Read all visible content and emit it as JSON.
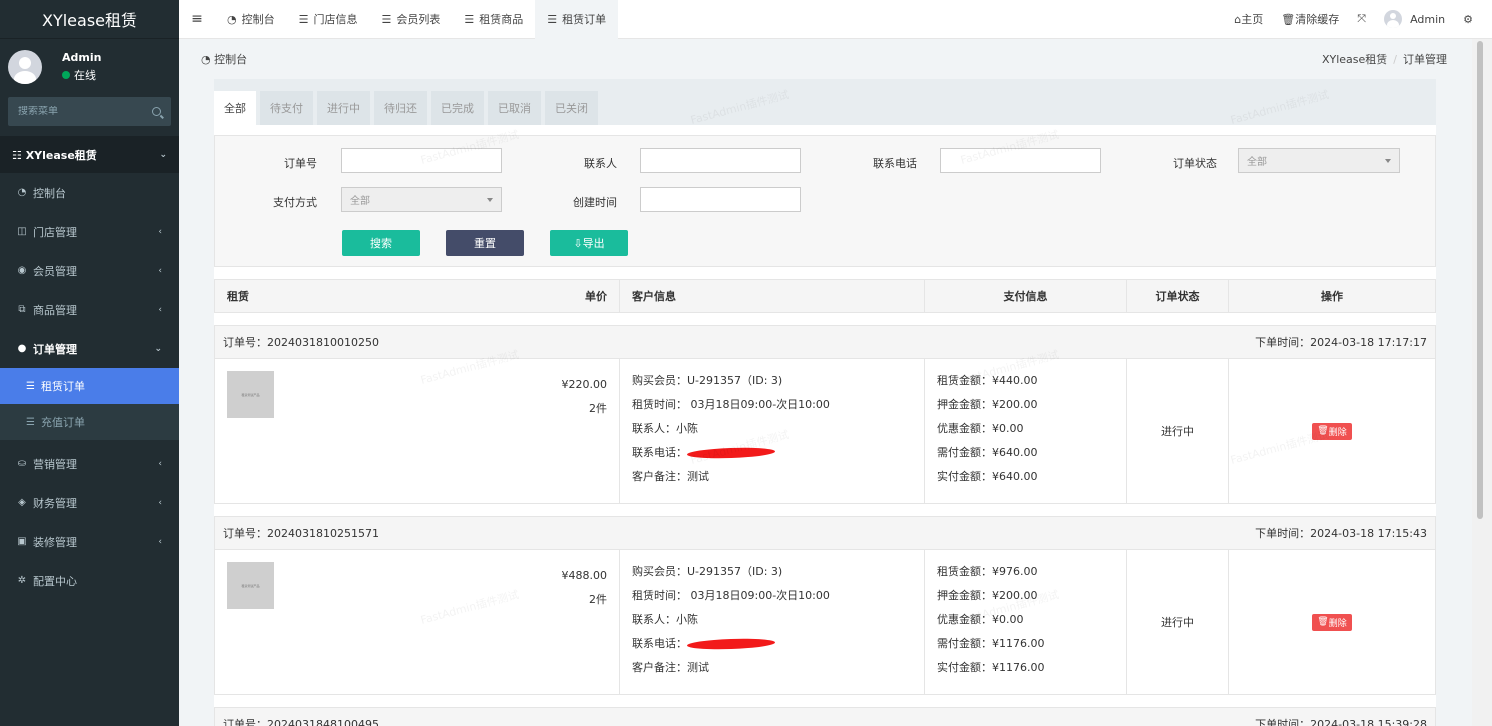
{
  "brand": "XYlease租赁",
  "user": {
    "name": "Admin",
    "status": "在线"
  },
  "sidebar": {
    "search_placeholder": "搜索菜单",
    "header": "XYlease租赁",
    "items": [
      {
        "label": "控制台",
        "icon": "dashboard-icon"
      },
      {
        "label": "门店管理",
        "icon": "store-icon"
      },
      {
        "label": "会员管理",
        "icon": "user-icon"
      },
      {
        "label": "商品管理",
        "icon": "goods-icon"
      },
      {
        "label": "订单管理",
        "icon": "order-icon"
      },
      {
        "label": "营销管理",
        "icon": "marketing-icon"
      },
      {
        "label": "财务管理",
        "icon": "finance-icon"
      },
      {
        "label": "装修管理",
        "icon": "decorate-icon"
      },
      {
        "label": "配置中心",
        "icon": "gear-icon"
      }
    ],
    "sub_items": [
      {
        "label": "租赁订单"
      },
      {
        "label": "充值订单"
      }
    ]
  },
  "topnav": {
    "tabs": [
      "控制台",
      "门店信息",
      "会员列表",
      "租赁商品",
      "租赁订单"
    ],
    "home": "主页",
    "clear_cache": "清除缓存",
    "admin": "Admin"
  },
  "breadcrumb": {
    "left": "控制台",
    "right_1": "XYlease租赁",
    "right_2": "订单管理"
  },
  "status_tabs": [
    "全部",
    "待支付",
    "进行中",
    "待归还",
    "已完成",
    "已取消",
    "已关闭"
  ],
  "filter": {
    "order_no_label": "订单号",
    "contact_label": "联系人",
    "phone_label": "联系电话",
    "order_status_label": "订单状态",
    "order_status_value": "全部",
    "pay_method_label": "支付方式",
    "pay_method_value": "全部",
    "create_time_label": "创建时间",
    "search_btn": "搜索",
    "reset_btn": "重置",
    "export_btn": "导出"
  },
  "table_headers": {
    "lease": "租赁",
    "price": "单价",
    "customer": "客户信息",
    "payment": "支付信息",
    "status": "订单状态",
    "action": "操作"
  },
  "orders": [
    {
      "order_no": "订单号：2024031810010250",
      "time": "下单时间：2024-03-18 17:17:17",
      "thumb_text": "租赁测试产品",
      "price": "¥220.00",
      "qty": "2件",
      "member": "购买会员：U-291357（ID: 3)",
      "lease_time": "租赁时间：  03月18日09:00-次日10:00",
      "contact": "联系人：小陈",
      "phone_label": "联系电话：",
      "remark": "客户备注：测试",
      "lease_amount": "租赁金额：¥440.00",
      "deposit": "押金金额：¥200.00",
      "discount": "优惠金额：¥0.00",
      "payable": "需付金额：¥640.00",
      "paid": "实付金额：¥640.00",
      "status": "进行中",
      "delete": "删除"
    },
    {
      "order_no": "订单号：2024031810251571",
      "time": "下单时间：2024-03-18 17:15:43",
      "thumb_text": "租赁测试产品",
      "price": "¥488.00",
      "qty": "2件",
      "member": "购买会员：U-291357（ID: 3)",
      "lease_time": "租赁时间：  03月18日09:00-次日10:00",
      "contact": "联系人：小陈",
      "phone_label": "联系电话：",
      "remark": "客户备注：测试",
      "lease_amount": "租赁金额：¥976.00",
      "deposit": "押金金额：¥200.00",
      "discount": "优惠金额：¥0.00",
      "payable": "需付金额：¥1176.00",
      "paid": "实付金额：¥1176.00",
      "status": "进行中",
      "delete": "删除"
    },
    {
      "order_no": "订单号：2024031848100495",
      "time": "下单时间：2024-03-18 15:39:28"
    }
  ],
  "watermark": "FastAdmin插件测试"
}
